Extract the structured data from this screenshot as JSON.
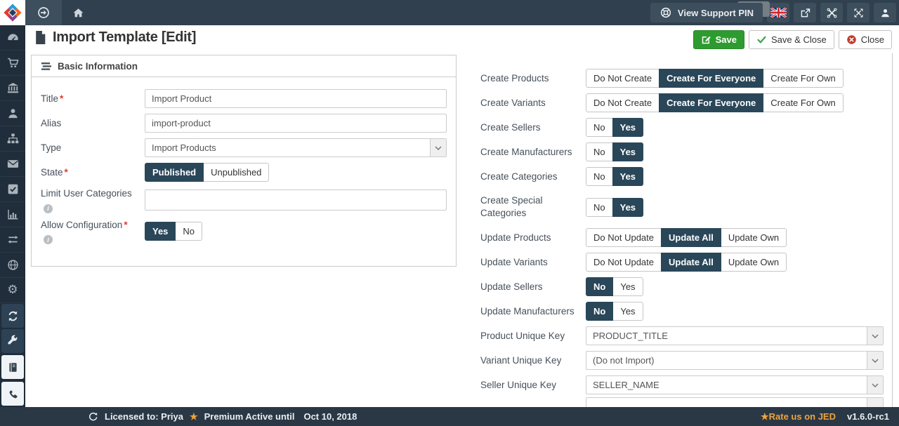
{
  "topbar": {
    "support_pin_label": "View Support PIN"
  },
  "page": {
    "title": "Import Template [Edit]"
  },
  "toolbar": {
    "save": "Save",
    "save_and_close": "Save & Close",
    "close": "Close"
  },
  "panel": {
    "title": "Basic Information"
  },
  "form": {
    "title": {
      "label": "Title",
      "required": true,
      "value": "Import Product"
    },
    "alias": {
      "label": "Alias",
      "value": "import-product"
    },
    "type": {
      "label": "Type",
      "value": "Import Products"
    },
    "state": {
      "label": "State",
      "required": true,
      "options": [
        "Published",
        "Unpublished"
      ],
      "active": 0
    },
    "limit_user_categories": {
      "label": "Limit User Categories",
      "value": ""
    },
    "allow_configuration": {
      "label": "Allow Configuration",
      "required": true,
      "options": [
        "Yes",
        "No"
      ],
      "active": 0
    }
  },
  "settings": {
    "rows": [
      {
        "label": "Create Products",
        "options": [
          "Do Not Create",
          "Create For Everyone",
          "Create For Own"
        ],
        "active": 1
      },
      {
        "label": "Create Variants",
        "options": [
          "Do Not Create",
          "Create For Everyone",
          "Create For Own"
        ],
        "active": 1
      },
      {
        "label": "Create Sellers",
        "options": [
          "No",
          "Yes"
        ],
        "active": 1
      },
      {
        "label": "Create Manufacturers",
        "options": [
          "No",
          "Yes"
        ],
        "active": 1
      },
      {
        "label": "Create Categories",
        "options": [
          "No",
          "Yes"
        ],
        "active": 1
      },
      {
        "label": "Create Special Categories",
        "options": [
          "No",
          "Yes"
        ],
        "active": 1
      },
      {
        "label": "Update Products",
        "options": [
          "Do Not Update",
          "Update All",
          "Update Own"
        ],
        "active": 1
      },
      {
        "label": "Update Variants",
        "options": [
          "Do Not Update",
          "Update All",
          "Update Own"
        ],
        "active": 1
      },
      {
        "label": "Update Sellers",
        "options": [
          "No",
          "Yes"
        ],
        "active": 0
      },
      {
        "label": "Update Manufacturers",
        "options": [
          "No",
          "Yes"
        ],
        "active": 0
      },
      {
        "label": "Product Unique Key",
        "value": "PRODUCT_TITLE"
      },
      {
        "label": "Variant Unique Key",
        "value": "(Do not Import)"
      },
      {
        "label": "Seller Unique Key",
        "value": "SELLER_NAME"
      }
    ]
  },
  "footer": {
    "licensed": "Licensed to: Priya",
    "premium": "Premium Active until",
    "premium_date": "Oct 10, 2018",
    "rate": "Rate us on JED",
    "version": "v1.6.0-rc1"
  },
  "ui": {
    "required_marker": "*",
    "info_glyph": "i",
    "gear_glyph": "⚙",
    "star_glyph": "★"
  },
  "colors": {
    "topbar": "#30404f",
    "sidebar": "#202d3a",
    "active_toggle": "#2a4759",
    "save_green": "#2e9b30",
    "accent_orange": "#f0a23c",
    "close_red": "#c23a2b"
  }
}
